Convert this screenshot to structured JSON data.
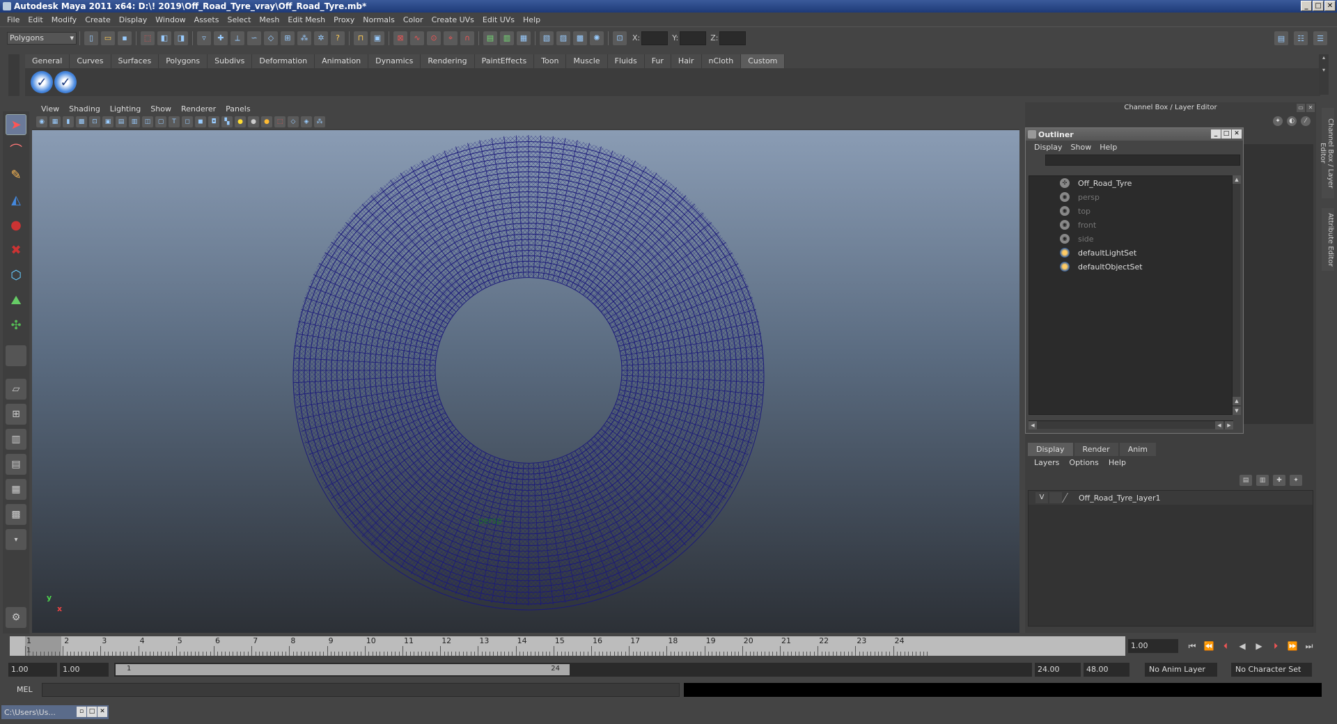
{
  "window": {
    "title": "Autodesk Maya 2011 x64: D:\\! 2019\\Off_Road_Tyre_vray\\Off_Road_Tyre.mb*",
    "controls": [
      "_",
      "□",
      "✕"
    ]
  },
  "menubar": [
    "File",
    "Edit",
    "Modify",
    "Create",
    "Display",
    "Window",
    "Assets",
    "Select",
    "Mesh",
    "Edit Mesh",
    "Proxy",
    "Normals",
    "Color",
    "Create UVs",
    "Edit UVs",
    "Help"
  ],
  "statusline": {
    "mode": "Polygons",
    "x_label": "X:",
    "y_label": "Y:",
    "z_label": "Z:"
  },
  "shelf": {
    "tabs": [
      "General",
      "Curves",
      "Surfaces",
      "Polygons",
      "Subdivs",
      "Deformation",
      "Animation",
      "Dynamics",
      "Rendering",
      "PaintEffects",
      "Toon",
      "Muscle",
      "Fluids",
      "Fur",
      "Hair",
      "nCloth",
      "Custom"
    ],
    "active_tab": "Custom"
  },
  "viewport": {
    "menu": [
      "View",
      "Shading",
      "Lighting",
      "Show",
      "Renderer",
      "Panels"
    ],
    "camera_label": "persp",
    "axis_y": "y",
    "axis_x": "x",
    "wire_color": "#1c1a7a"
  },
  "channel_box": {
    "header": "Channel Box / Layer Editor"
  },
  "outliner": {
    "title": "Outliner",
    "menu": [
      "Display",
      "Show",
      "Help"
    ],
    "items": [
      {
        "label": "Off_Road_Tyre",
        "dim": false,
        "icon": "transform-icon"
      },
      {
        "label": "persp",
        "dim": true,
        "icon": "camera-icon"
      },
      {
        "label": "top",
        "dim": true,
        "icon": "camera-icon"
      },
      {
        "label": "front",
        "dim": true,
        "icon": "camera-icon"
      },
      {
        "label": "side",
        "dim": true,
        "icon": "camera-icon"
      },
      {
        "label": "defaultLightSet",
        "dim": false,
        "icon": "set-icon"
      },
      {
        "label": "defaultObjectSet",
        "dim": false,
        "icon": "set-icon"
      }
    ]
  },
  "layer_editor": {
    "tabs": [
      "Display",
      "Render",
      "Anim"
    ],
    "active_tab": "Display",
    "menu": [
      "Layers",
      "Options",
      "Help"
    ],
    "layers": [
      {
        "visible": "V",
        "name": "Off_Road_Tyre_layer1"
      }
    ]
  },
  "side_tabs": [
    "Channel Box / Layer Editor",
    "Attribute Editor"
  ],
  "timeline": {
    "ticks": [
      "1",
      "2",
      "3",
      "4",
      "5",
      "6",
      "7",
      "8",
      "9",
      "10",
      "11",
      "12",
      "13",
      "14",
      "15",
      "16",
      "17",
      "18",
      "19",
      "20",
      "21",
      "22",
      "23",
      "24"
    ],
    "current_frame": "1",
    "current_time_field": "1.00"
  },
  "range": {
    "start_time": "1.00",
    "playback_start": "1.00",
    "range_low": "1",
    "range_high": "24",
    "playback_end": "24.00",
    "end_time": "48.00",
    "anim_layer": "No Anim Layer",
    "character_set": "No Character Set"
  },
  "commandline": {
    "label": "MEL"
  },
  "taskbar": {
    "item": "C:\\Users\\Us..."
  }
}
